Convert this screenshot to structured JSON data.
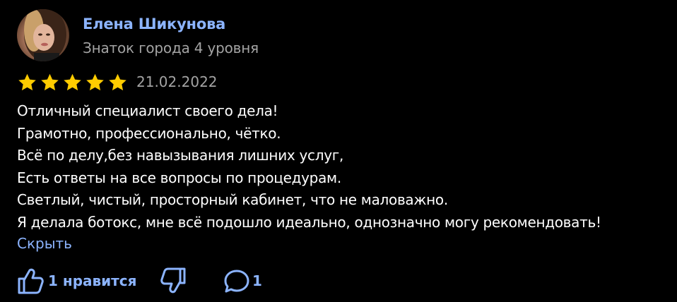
{
  "author": {
    "name": "Елена Шикунова",
    "level": "Знаток города 4 уровня"
  },
  "review": {
    "rating": 5,
    "max_rating": 5,
    "date": "21.02.2022",
    "lines": [
      "Отличный специалист своего дела!",
      "Грамотно, профессионально, чётко.",
      "Всё по делу,без навызывания лишних услуг,",
      "Есть ответы на все вопросы по процедурам.",
      "Светлый, чистый, просторный кабинет, что не маловажно.",
      "Я делала ботокс, мне всё подошло идеально, однозначно могу рекомендовать!"
    ],
    "hide_label": "Скрыть"
  },
  "actions": {
    "like_label": "1 нравится",
    "like_icon": "thumbs-up-icon",
    "dislike_icon": "thumbs-down-icon",
    "comment_icon": "comment-icon",
    "comment_count": "1"
  },
  "colors": {
    "background": "#000000",
    "link": "#8cb4ff",
    "muted": "#a3a3a3",
    "star": "#ffcc00",
    "text": "#ffffff"
  }
}
